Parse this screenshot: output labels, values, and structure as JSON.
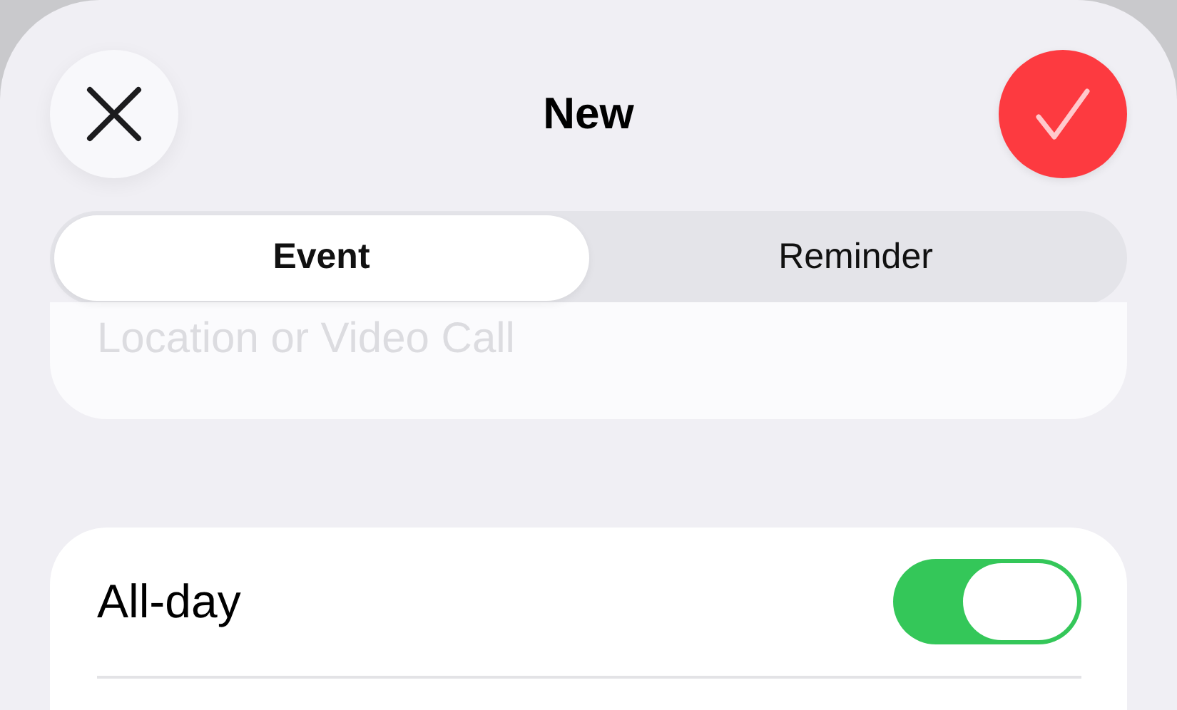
{
  "header": {
    "title": "New"
  },
  "segments": [
    {
      "label": "Event",
      "selected": true
    },
    {
      "label": "Reminder",
      "selected": false
    }
  ],
  "location_field": {
    "placeholder": "Location or Video Call"
  },
  "settings": [
    {
      "kind": "toggle",
      "label": "All-day",
      "on": true
    }
  ]
}
